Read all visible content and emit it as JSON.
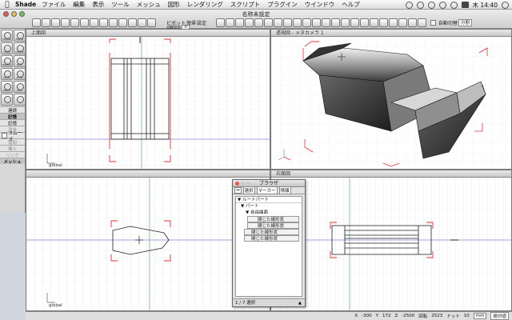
{
  "menubar": {
    "apple": "",
    "app": "Shade",
    "items": [
      "ファイル",
      "編集",
      "表示",
      "ツール",
      "メッシュ",
      "図形",
      "レンダリング",
      "スクリプト",
      "プラグイン",
      "ウインドウ",
      "ヘルプ"
    ],
    "clock": "木 14:40"
  },
  "window": {
    "title": "名称未設定"
  },
  "toolbar": {
    "pivot_label": "ピボット",
    "restore_label": "復帰",
    "settings_label": "設定",
    "coord_label": "X軸固定",
    "coord_value": "0",
    "auto_switch_label": "自動切替",
    "split_select": "分割"
  },
  "palette": {
    "tools": [
      "create",
      "move",
      "copy",
      "rotate",
      "modify",
      "edit",
      "tools",
      "view",
      "zoom",
      "pan",
      "",
      ""
    ],
    "rows": [
      {
        "label": "連続",
        "state": "normal"
      },
      {
        "label": "記憶",
        "state": "sel"
      },
      {
        "label": "記憶",
        "state": "normal"
      },
      {
        "label": "消去",
        "state": "dim"
      },
      {
        "label": "スムーズ",
        "state": "left"
      },
      {
        "label": "追加",
        "state": "dim"
      },
      {
        "label": "挿入",
        "state": "dim"
      },
      {
        "label": "リンク",
        "state": "dim"
      }
    ],
    "footer": "メッシュ"
  },
  "viewports": {
    "top": {
      "title": "上面図",
      "global": "global"
    },
    "perspective": {
      "title": "透視図 - メタカメラ 1"
    },
    "front": {
      "title": "",
      "global": "global"
    },
    "right": {
      "title": "右面図"
    }
  },
  "browser": {
    "title": "ブラウザ",
    "menus": [
      "選択",
      "マーカー",
      "情報"
    ],
    "tree": {
      "root": "ルートパート",
      "part": "パート",
      "freeform": "自由曲面",
      "closed_items": [
        "閉じた線形状",
        "閉じた線形状",
        "閉じた線形状",
        "閉じた線形状"
      ]
    },
    "footer": "1 / 7 選択"
  },
  "statusbar": {
    "x_label": "X",
    "x_value": "-300",
    "y_label": "Y",
    "y_value": "172",
    "z_label": "Z",
    "z_value": "-2500",
    "scale_label": "回転",
    "scale_value": "2523",
    "unit_label": "ドット",
    "unit_value": "10",
    "unit_select": "mm",
    "mode": "絶対値"
  },
  "colors": {
    "selection_red": "#e03030",
    "axis_green": "#6fa86f",
    "axis_blue": "#8088d8",
    "model_stroke": "#222222",
    "grid": "#e3e3e3"
  }
}
